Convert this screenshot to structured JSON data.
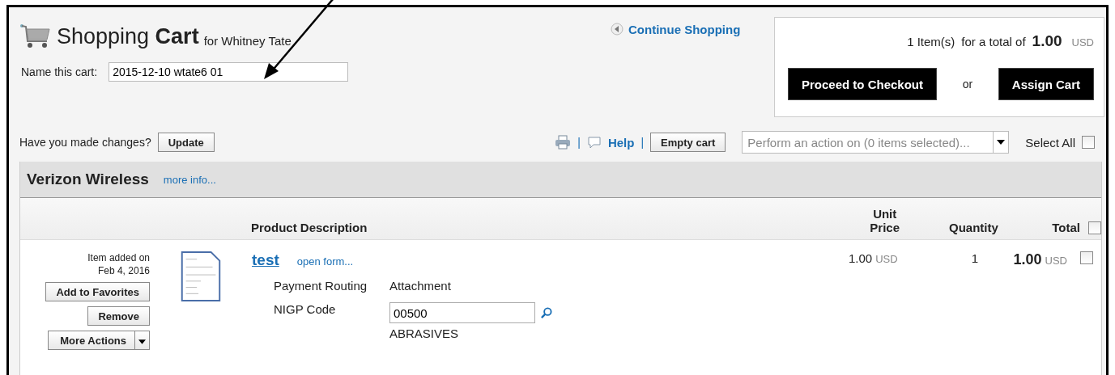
{
  "header": {
    "title": "Shopping **Cart**",
    "subtitle": "for Whitney Tate",
    "name_label": "Name this cart:",
    "name_value": "2015-12-10 wtate6 01",
    "continue": "Continue Shopping"
  },
  "summary": {
    "count": "1 Item(s)",
    "text": "for a total of",
    "total": "1.00",
    "currency": "USD",
    "checkout": "Proceed to Checkout",
    "or": "or",
    "assign": "Assign Cart"
  },
  "toolbar": {
    "changes": "Have you made changes?",
    "update": "Update",
    "sep": "|",
    "help": "Help",
    "empty": "Empty cart",
    "action_placeholder": "Perform an action on (0 items selected)...",
    "select_all": "Select All",
    "select_all_checked": false
  },
  "supplier": {
    "name": "Verizon Wireless",
    "more": "more info..."
  },
  "columns": {
    "description": "Product Description",
    "unit_price": "Unit\nPrice",
    "quantity": "Quantity",
    "total": "Total",
    "total_checked": false
  },
  "items": [
    {
      "added": "Item added on\nFeb 4, 2016",
      "favorites": "Add to Favorites",
      "remove": "Remove",
      "more_actions": "More Actions",
      "name": "test",
      "open_form": "open form...",
      "fields": [
        {
          "label": "Payment Routing",
          "kind": "text",
          "value": "Attachment"
        },
        {
          "label": "NIGP Code",
          "kind": "lookup",
          "value": "00500",
          "note": "ABRASIVES"
        }
      ],
      "unit_price": "1.00",
      "unit_currency": "USD",
      "quantity": "1",
      "total": "1.00",
      "total_currency": "USD",
      "checked": false
    }
  ]
}
